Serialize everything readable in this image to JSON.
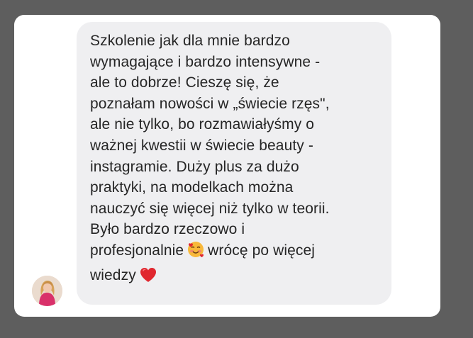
{
  "message": {
    "lines": [
      "Szkolenie jak dla mnie bardzo",
      "wymagające i bardzo intensywne -",
      "ale to dobrze! Cieszę się, że",
      "poznałam nowości w „świecie rzęs\",",
      "ale nie tylko, bo rozmawiałyśmy o",
      "ważnej kwestii w świecie beauty -",
      "instagramie. Duży plus za dużo",
      "praktyki, na modelkach można",
      "nauczyć się więcej niż tylko w teorii.",
      "Było bardzo rzeczowo i"
    ],
    "line_emoji_before": "profesjonalnie",
    "line_emoji_after": "wrócę po więcej",
    "last_line": "wiedzy",
    "emoji_smiling_hearts": "smiling-face-with-hearts-icon",
    "emoji_heart": "red-heart-icon"
  },
  "colors": {
    "background": "#5e5e5e",
    "card": "#ffffff",
    "bubble": "#efeff1",
    "text": "#262626",
    "heart": "#e0272f",
    "emoji_face": "#f8b83a"
  },
  "sender": {
    "avatar_icon": "user-avatar-photo"
  }
}
